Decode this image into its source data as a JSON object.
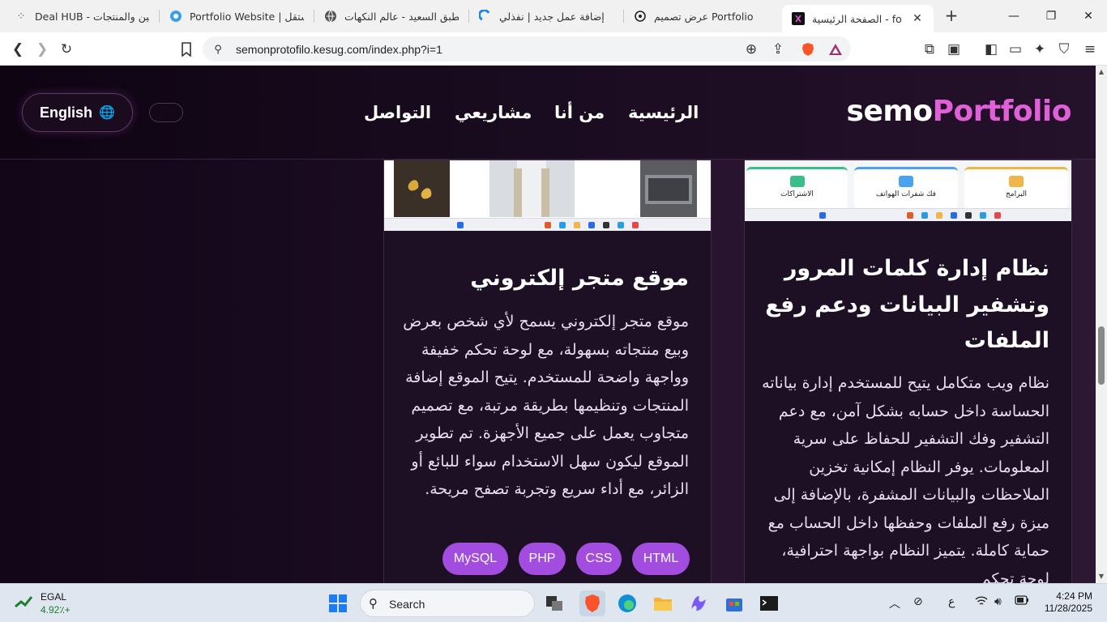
{
  "browser": {
    "tabs": [
      {
        "title": "Deal HUB - العين والمنتجات",
        "icon": "dots-icon"
      },
      {
        "title": "Portfolio Website | مستقل",
        "icon": "blue-circle-icon"
      },
      {
        "title": "الطبق السعيد - عالم النكهات",
        "icon": "globe-icon"
      },
      {
        "title": "إضافة عمل جديد | نفذلي",
        "icon": "nafezly-icon"
      },
      {
        "title": "عرض تصميم Portfolio",
        "icon": "openai-icon"
      },
      {
        "title": "الصفحة الرئيسية - folio",
        "icon": "site-favicon"
      }
    ],
    "url": "semonprotofilo.kesug.com/index.php?i=1"
  },
  "site": {
    "logo_main": "semo",
    "logo_accent": "Portfolio",
    "nav": [
      "الرئيسية",
      "من أنا",
      "مشاريعي",
      "التواصل"
    ],
    "lang_button": "English",
    "accent_color": "#a24ce0",
    "logo_accent_color": "#e060d8"
  },
  "projects": [
    {
      "title": "نظام إدارة كلمات المرور وتشفير البيانات ودعم رفع الملفات",
      "description": "نظام ويب متكامل يتيح للمستخدم إدارة بياناته الحساسة داخل حسابه بشكل آمن، مع دعم التشفير وفك التشفير للحفاظ على سرية المعلومات. يوفر النظام إمكانية تخزين الملاحظات والبيانات المشفرة، بالإضافة إلى ميزة رفع الملفات وحفظها داخل الحساب مع حماية كاملة. يتميز النظام بواجهة احترافية، لوحة تحكم",
      "thumb_tiles": [
        "البرامج",
        "فك شفرات الهواتف",
        "الاشتراكات"
      ]
    },
    {
      "title": "موقع متجر إلكتروني",
      "description": "موقع متجر إلكتروني يسمح لأي شخص بعرض وبيع منتجاته بسهولة، مع لوحة تحكم خفيفة وواجهة واضحة للمستخدم. يتيح الموقع إضافة المنتجات وتنظيمها بطريقة مرتبة، مع تصميم متجاوب يعمل على جميع الأجهزة. تم تطوير الموقع ليكون سهل الاستخدام سواء للبائع أو الزائر، مع أداء سريع وتجربة تصفح مريحة.",
      "tags": [
        "HTML",
        "CSS",
        "PHP",
        "MySQL"
      ]
    }
  ],
  "taskbar": {
    "stock_name": "EGAL",
    "stock_change": "4.92٪+",
    "search_label": "Search",
    "time": "4:24 PM",
    "date": "11/28/2025",
    "lang_indicator": "ع"
  }
}
